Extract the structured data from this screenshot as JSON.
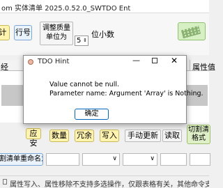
{
  "window": {
    "title": "om 实体清单  2025.0.52.0_SWTDO Ent"
  },
  "toolbar": {
    "left_button_partial": "计",
    "row_number_button": "行号",
    "adjust_unit_line1": "调整质量",
    "adjust_unit_line2": "单位为",
    "decimal_value": "5",
    "decimal_label": "位小数"
  },
  "table": {
    "left_header_partial": "经",
    "right_header_partial": "属性值"
  },
  "dialog": {
    "title": "TDO Hint",
    "message_line1": "Value cannot be null.",
    "message_line2": "Parameter name: Argument 'Array' is Nothing.",
    "ok_label": "确定"
  },
  "actions": {
    "left_partial": "应安",
    "quantity": "数量",
    "redundant": "冗余",
    "write": "写入",
    "manual_update": "手动更新",
    "read": "读取",
    "switch_line1": "切割清",
    "switch_line2": "格式"
  },
  "rename": {
    "label": "割清单重命名为"
  },
  "status": {
    "text": "属性写入、属性移除不支持多选操作，仅跟表格有关，其他命令支持多选"
  }
}
